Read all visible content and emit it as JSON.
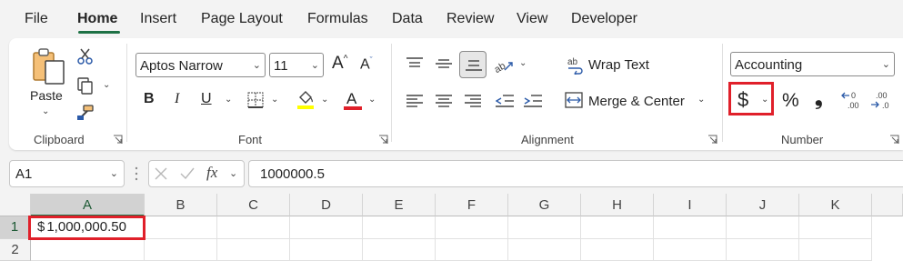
{
  "menu": {
    "tabs": [
      "File",
      "Home",
      "Insert",
      "Page Layout",
      "Formulas",
      "Data",
      "Review",
      "View",
      "Developer"
    ],
    "active_tab": "Home"
  },
  "clipboard": {
    "paste_label": "Paste",
    "group_label": "Clipboard"
  },
  "font": {
    "font_name": "Aptos Narrow",
    "font_size": "11",
    "grow_label": "A",
    "shrink_label": "A",
    "bold_label": "B",
    "italic_label": "I",
    "underline_label": "U",
    "font_color_label": "A",
    "highlight_color": "#ffff00",
    "font_color": "#e0202a",
    "group_label": "Font"
  },
  "alignment": {
    "wrap_text_label": "Wrap Text",
    "merge_center_label": "Merge & Center",
    "group_label": "Alignment"
  },
  "number": {
    "format_value": "Accounting",
    "currency_symbol": "$",
    "percent_symbol": "%",
    "comma_symbol": "❟",
    "increase_decimal_label": ".00",
    "decrease_decimal_label": ".00",
    "group_label": "Number"
  },
  "formula_bar": {
    "name_box": "A1",
    "fx_label": "fx",
    "formula_value": "1000000.5"
  },
  "sheet": {
    "columns": [
      "A",
      "B",
      "C",
      "D",
      "E",
      "F",
      "G",
      "H",
      "I",
      "J",
      "K"
    ],
    "rows": [
      "1",
      "2"
    ],
    "a1_currency": "$",
    "a1_value": "1,000,000.50"
  },
  "colors": {
    "accent": "#1e7145",
    "highlight_box": "#e0202a"
  }
}
